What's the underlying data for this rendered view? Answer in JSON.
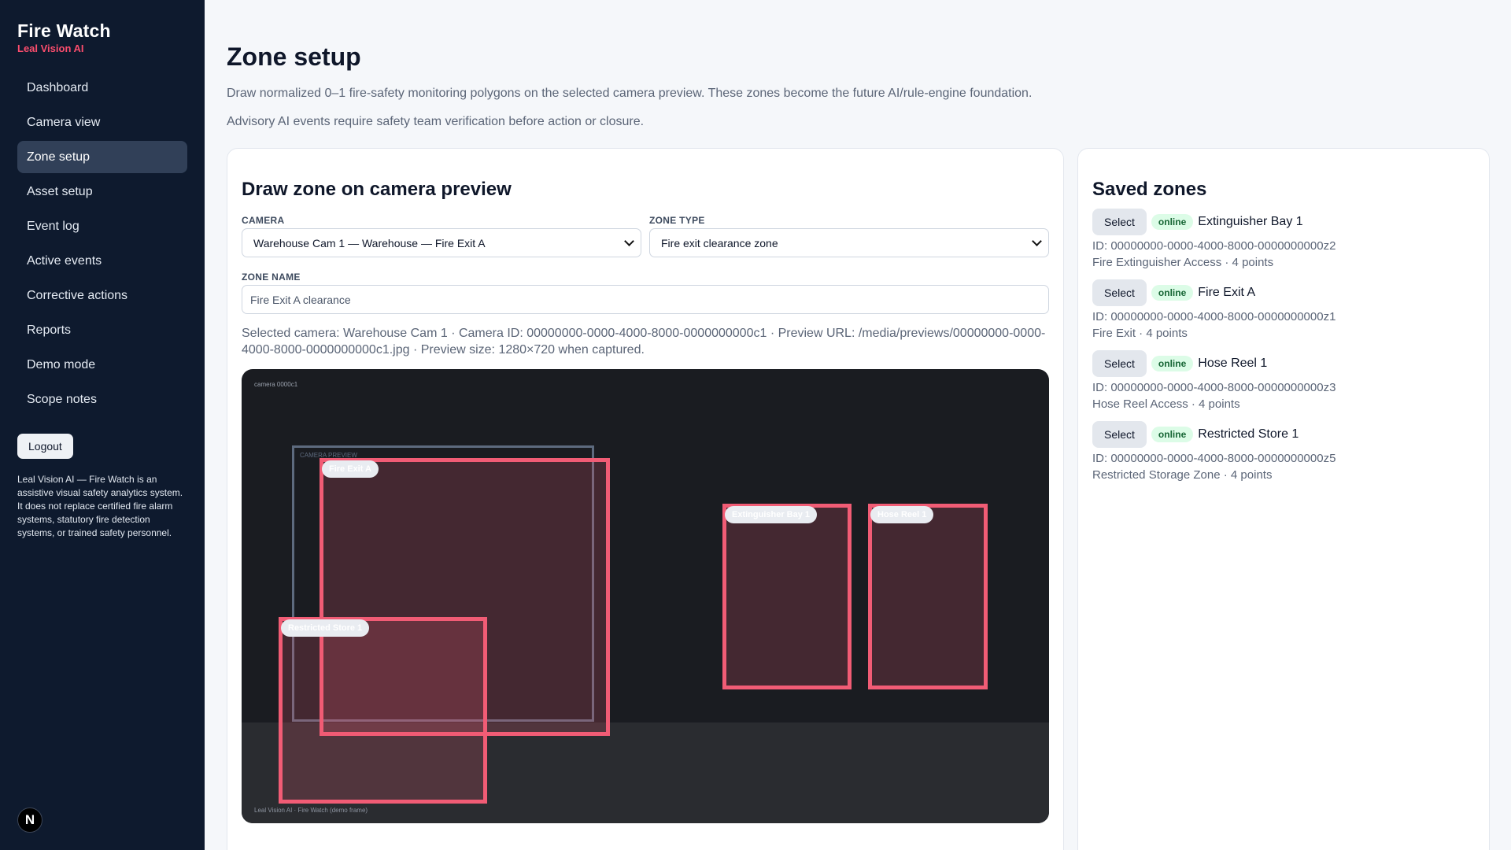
{
  "brand": {
    "title": "Fire Watch",
    "subtitle": "Leal Vision AI"
  },
  "nav": [
    {
      "label": "Dashboard",
      "active": false
    },
    {
      "label": "Camera view",
      "active": false
    },
    {
      "label": "Zone setup",
      "active": true
    },
    {
      "label": "Asset setup",
      "active": false
    },
    {
      "label": "Event log",
      "active": false
    },
    {
      "label": "Active events",
      "active": false
    },
    {
      "label": "Corrective actions",
      "active": false
    },
    {
      "label": "Reports",
      "active": false
    },
    {
      "label": "Demo mode",
      "active": false
    },
    {
      "label": "Scope notes",
      "active": false
    }
  ],
  "logout_label": "Logout",
  "disclaimer": "Leal Vision AI — Fire Watch is an assistive visual safety analytics system. It does not replace certified fire alarm systems, statutory fire detection systems, or trained safety personnel.",
  "n_badge": "N",
  "page": {
    "title": "Zone setup",
    "description": "Draw normalized 0–1 fire-safety monitoring polygons on the selected camera preview. These zones become the future AI/rule-engine foundation.",
    "advisory": "Advisory AI events require safety team verification before action or closure."
  },
  "draw": {
    "title": "Draw zone on camera preview",
    "camera_label": "CAMERA",
    "camera_value": "Warehouse Cam 1 — Warehouse — Fire Exit A",
    "zone_type_label": "ZONE TYPE",
    "zone_type_value": "Fire exit clearance zone",
    "zone_name_label": "ZONE NAME",
    "zone_name_placeholder": "Fire Exit A clearance",
    "selected_info": "Selected camera: Warehouse Cam 1 · Camera ID: 00000000-0000-4000-8000-0000000000c1 · Preview URL: /media/previews/00000000-0000-4000-8000-0000000000c1.jpg · Preview size: 1280×720 when captured."
  },
  "preview": {
    "camera_tag": "camera 0000c1",
    "frame_label": "CAMERA PREVIEW",
    "footer": "Leal Vision AI · Fire Watch (demo frame)",
    "zones": [
      {
        "label": "Fire Exit A",
        "color": "#f15c75"
      },
      {
        "label": "Extinguisher Bay 1",
        "color": "#f15c75"
      },
      {
        "label": "Hose Reel 1",
        "color": "#f15c75"
      },
      {
        "label": "Restricted Store 1",
        "color": "#f15c75"
      }
    ]
  },
  "saved": {
    "title": "Saved zones",
    "select_label": "Select",
    "items": [
      {
        "status": "online",
        "name": "Extinguisher Bay 1",
        "id": "ID: 00000000-0000-4000-8000-0000000000z2",
        "meta": "Fire Extinguisher Access · 4 points"
      },
      {
        "status": "online",
        "name": "Fire Exit A",
        "id": "ID: 00000000-0000-4000-8000-0000000000z1",
        "meta": "Fire Exit · 4 points"
      },
      {
        "status": "online",
        "name": "Hose Reel 1",
        "id": "ID: 00000000-0000-4000-8000-0000000000z3",
        "meta": "Hose Reel Access · 4 points"
      },
      {
        "status": "online",
        "name": "Restricted Store 1",
        "id": "ID: 00000000-0000-4000-8000-0000000000z5",
        "meta": "Restricted Storage Zone · 4 points"
      }
    ]
  },
  "colors": {
    "sidebar": "#0e1a2e",
    "accent": "#fb4d6d",
    "zone": "#f15c75",
    "online_bg": "#dcfce7",
    "online_text": "#166534"
  }
}
